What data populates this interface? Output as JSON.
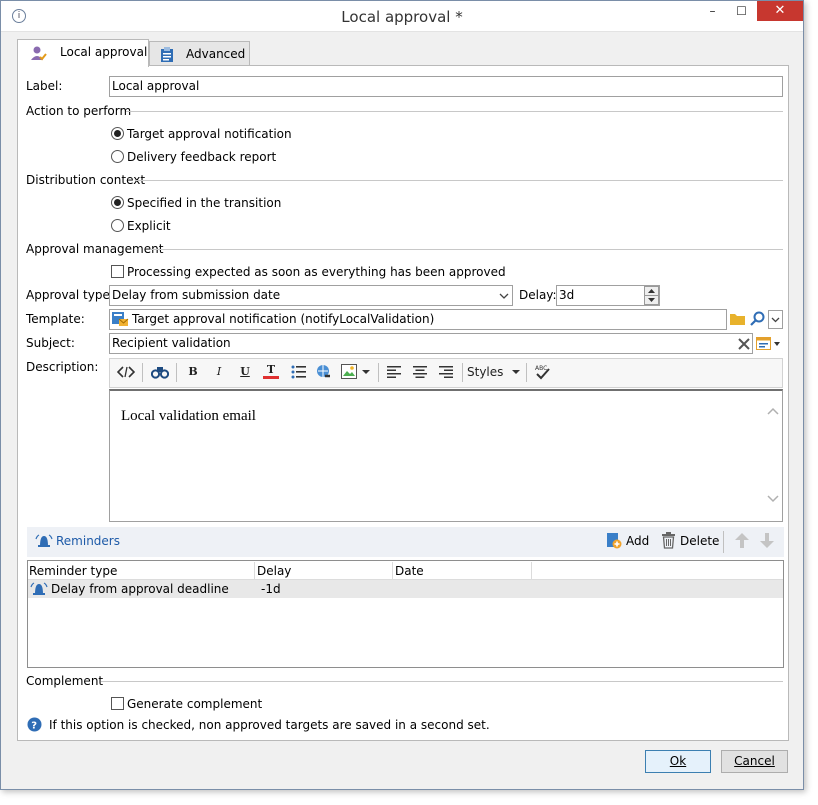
{
  "window": {
    "title": "Local approval *",
    "minimize": "–",
    "maximize": "☐",
    "close": "✕",
    "app_icon": "i"
  },
  "tabs": [
    {
      "label": "Local approval"
    },
    {
      "label": "Advanced"
    }
  ],
  "form": {
    "label_caption": "Label:",
    "label_value": "Local approval",
    "action_section": "Action to perform",
    "action_options": [
      "Target approval notification",
      "Delivery feedback report"
    ],
    "distribution_section": "Distribution context",
    "distribution_options": [
      "Specified in the transition",
      "Explicit"
    ],
    "approval_section": "Approval management",
    "processing_check": "Processing expected as soon as everything has been approved",
    "approval_type_caption": "Approval type:",
    "approval_type_value": "Delay from submission date",
    "delay_caption": "Delay:",
    "delay_value": "3d",
    "template_caption": "Template:",
    "template_value": "Target approval notification (notifyLocalValidation)",
    "subject_caption": "Subject:",
    "subject_value": "Recipient validation",
    "description_caption": "Description:"
  },
  "editor": {
    "bold": "B",
    "italic": "I",
    "underline": "U",
    "text_color": "T",
    "styles": "Styles",
    "body_text": "Local validation email"
  },
  "reminders": {
    "title": "Reminders",
    "add": "Add",
    "delete": "Delete",
    "columns": [
      "Reminder type",
      "Delay",
      "Date"
    ],
    "rows": [
      {
        "type": "Delay from approval deadline",
        "delay": "-1d",
        "date": ""
      }
    ]
  },
  "complement": {
    "section": "Complement",
    "check": "Generate complement",
    "hint": "If this option is checked, non approved targets are saved in a second set."
  },
  "footer": {
    "ok": "Ok",
    "cancel": "Cancel"
  }
}
